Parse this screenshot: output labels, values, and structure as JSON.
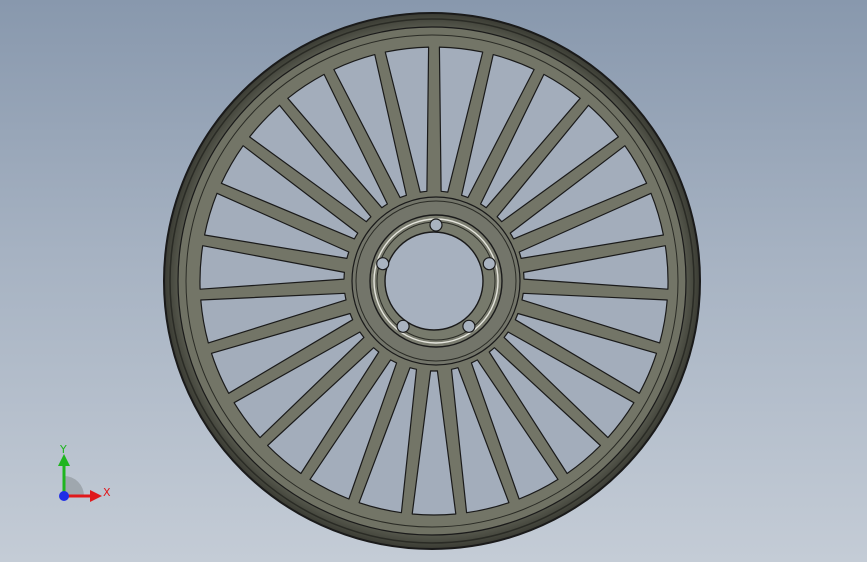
{
  "viewport": {
    "background_top": "#8898ad",
    "background_bottom": "#c4ccd6"
  },
  "model": {
    "part": "wheel",
    "spoke_count": 27,
    "bolt_hole_count": 5,
    "body_color": "#6c6e60",
    "edge_color": "#1a1a1a"
  },
  "triad": {
    "x_label": "X",
    "y_label": "Y",
    "x_color": "#e0181b",
    "y_color": "#1fb51f",
    "z_color": "#1f2ee6"
  }
}
